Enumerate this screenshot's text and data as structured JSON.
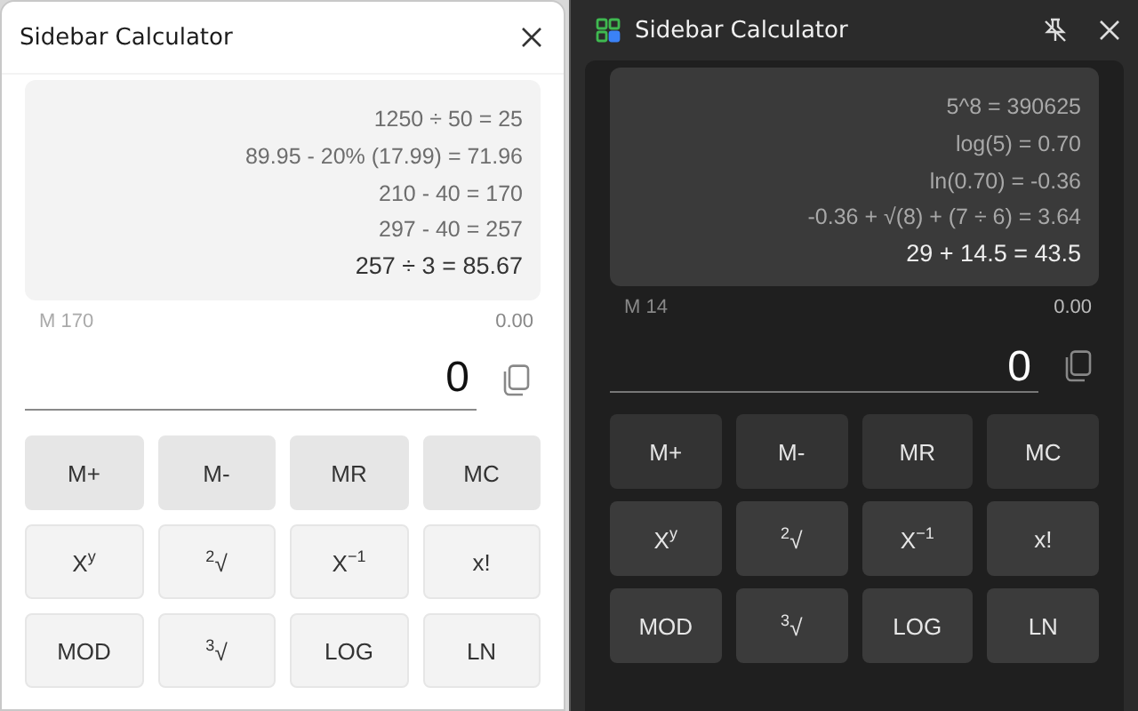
{
  "panels": [
    {
      "kind": "light",
      "title": "Sidebar Calculator",
      "history": [
        {
          "text": "1250 ÷ 50 = 25",
          "current": false
        },
        {
          "text": "89.95 - 20% (17.99) = 71.96",
          "current": false
        },
        {
          "text": "210 - 40 = 170",
          "current": false
        },
        {
          "text": "297 - 40 = 257",
          "current": false
        },
        {
          "text": "257 ÷ 3 = 85.67",
          "current": true
        }
      ],
      "memory": "M 170",
      "preview": "0.00",
      "display": "0",
      "buttons": [
        {
          "label": "M+",
          "kind": "memory"
        },
        {
          "label": "M-",
          "kind": "memory"
        },
        {
          "label": "MR",
          "kind": "memory"
        },
        {
          "label": "MC",
          "kind": "memory"
        },
        {
          "label": "X$^{y}$",
          "kind": "function"
        },
        {
          "label": "$^{2}$√",
          "kind": "function"
        },
        {
          "label": "X$^{−1}$",
          "kind": "function"
        },
        {
          "label": "x!",
          "kind": "function"
        },
        {
          "label": "MOD",
          "kind": "function"
        },
        {
          "label": "$^{3}$√",
          "kind": "function"
        },
        {
          "label": "LOG",
          "kind": "function"
        },
        {
          "label": "LN",
          "kind": "function"
        }
      ]
    },
    {
      "kind": "dark",
      "title": "Sidebar Calculator",
      "history": [
        {
          "text": "5^8 = 390625",
          "current": false
        },
        {
          "text": "log(5) = 0.70",
          "current": false
        },
        {
          "text": "ln(0.70) = -0.36",
          "current": false
        },
        {
          "text": "-0.36 + √(8) + (7 ÷ 6) = 3.64",
          "current": false
        },
        {
          "text": "29 + 14.5 = 43.5",
          "current": true
        }
      ],
      "memory": "M 14",
      "preview": "0.00",
      "display": "0",
      "buttons": [
        {
          "label": "M+",
          "kind": "memory"
        },
        {
          "label": "M-",
          "kind": "memory"
        },
        {
          "label": "MR",
          "kind": "memory"
        },
        {
          "label": "MC",
          "kind": "memory"
        },
        {
          "label": "X$^{y}$",
          "kind": "function"
        },
        {
          "label": "$^{2}$√",
          "kind": "function"
        },
        {
          "label": "X$^{−1}$",
          "kind": "function"
        },
        {
          "label": "x!",
          "kind": "function"
        },
        {
          "label": "MOD",
          "kind": "function"
        },
        {
          "label": "$^{3}$√",
          "kind": "function"
        },
        {
          "label": "LOG",
          "kind": "function"
        },
        {
          "label": "LN",
          "kind": "function"
        }
      ]
    }
  ]
}
